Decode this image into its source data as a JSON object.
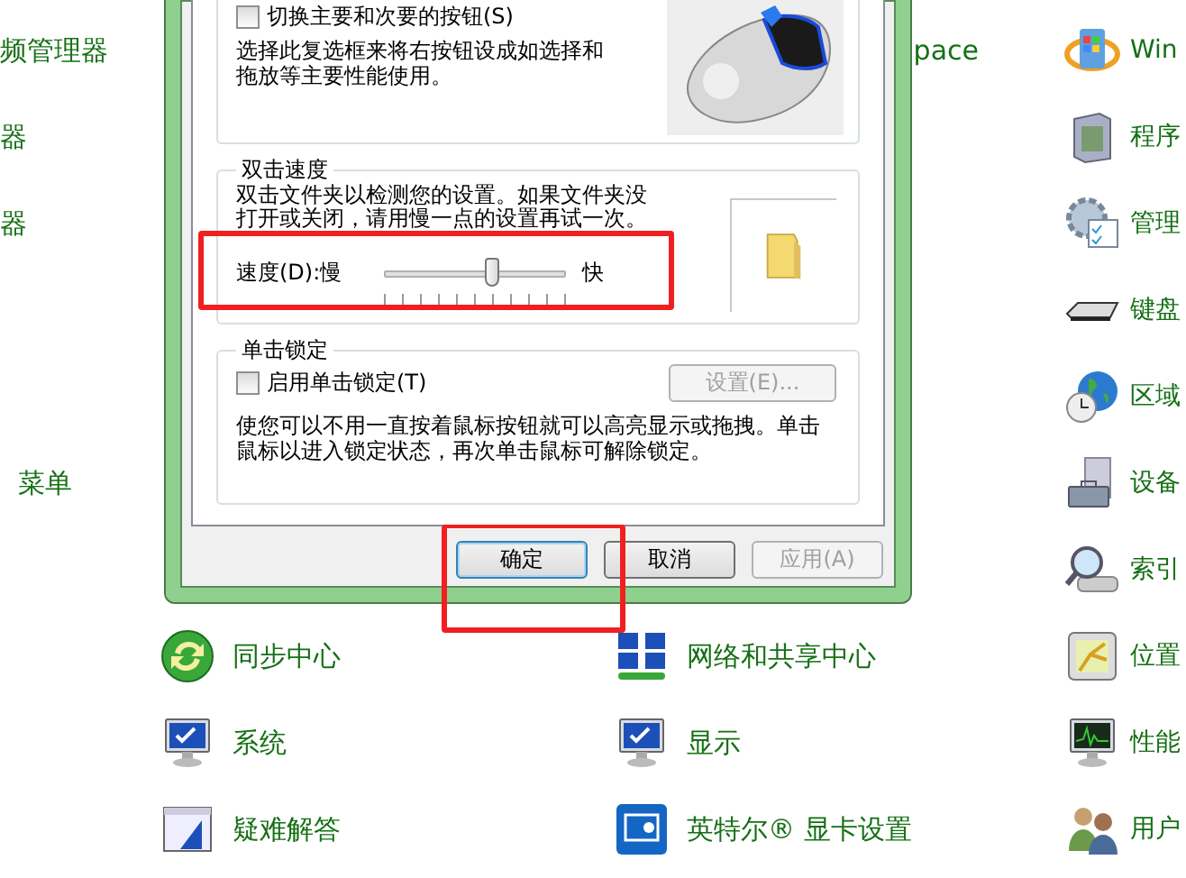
{
  "background": {
    "columns": [
      {
        "items": [
          {
            "label": "频管理器"
          },
          {
            "label": "器"
          },
          {
            "label": "器"
          },
          {
            "label": "菜单"
          }
        ]
      },
      {
        "items": [
          {
            "label": "同步中心",
            "kind": "sync"
          },
          {
            "label": "系统",
            "kind": "monitor"
          },
          {
            "label": "疑难解答",
            "kind": "window"
          }
        ]
      },
      {
        "items": [
          {
            "label": "pace"
          },
          {
            "label": "网络和共享中心",
            "kind": "network"
          },
          {
            "label": "显示",
            "kind": "display"
          },
          {
            "label": "英特尔® 显卡设置",
            "kind": "panel"
          }
        ]
      },
      {
        "items": [
          {
            "label": "Win",
            "kind": "flag"
          },
          {
            "label": "程序",
            "kind": "box"
          },
          {
            "label": "管理",
            "kind": "gear"
          },
          {
            "label": "键盘",
            "kind": "keyboard"
          },
          {
            "label": "区域",
            "kind": "globe"
          },
          {
            "label": "设备",
            "kind": "toolbox"
          },
          {
            "label": "索引",
            "kind": "magnifier"
          },
          {
            "label": "位置",
            "kind": "map"
          },
          {
            "label": "性能",
            "kind": "chart"
          },
          {
            "label": "用户",
            "kind": "people"
          }
        ]
      }
    ]
  },
  "dialog": {
    "swap_buttons": {
      "label": "切换主要和次要的按钮(S)",
      "checked": false,
      "description": "选择此复选框来将右按钮设成如选择和拖放等主要性能使用。"
    },
    "double_click": {
      "title": "双击速度",
      "description": "双击文件夹以检测您的设置。如果文件夹没打开或关闭，请用慢一点的设置再试一次。",
      "speed_label": "速度(D):慢",
      "fast_label": "快",
      "level": 0.6
    },
    "click_lock": {
      "title": "单击锁定",
      "checkbox": {
        "label": "启用单击锁定(T)",
        "checked": false
      },
      "settings_button": {
        "label": "设置(E)...",
        "disabled": true
      },
      "description": "使您可以不用一直按着鼠标按钮就可以高亮显示或拖拽。单击鼠标以进入锁定状态，再次单击鼠标可解除锁定。"
    },
    "buttons": [
      {
        "label": "确定",
        "default": true,
        "disabled": false
      },
      {
        "label": "取消",
        "default": false,
        "disabled": false
      },
      {
        "label": "应用(A)",
        "default": false,
        "disabled": true
      }
    ]
  }
}
